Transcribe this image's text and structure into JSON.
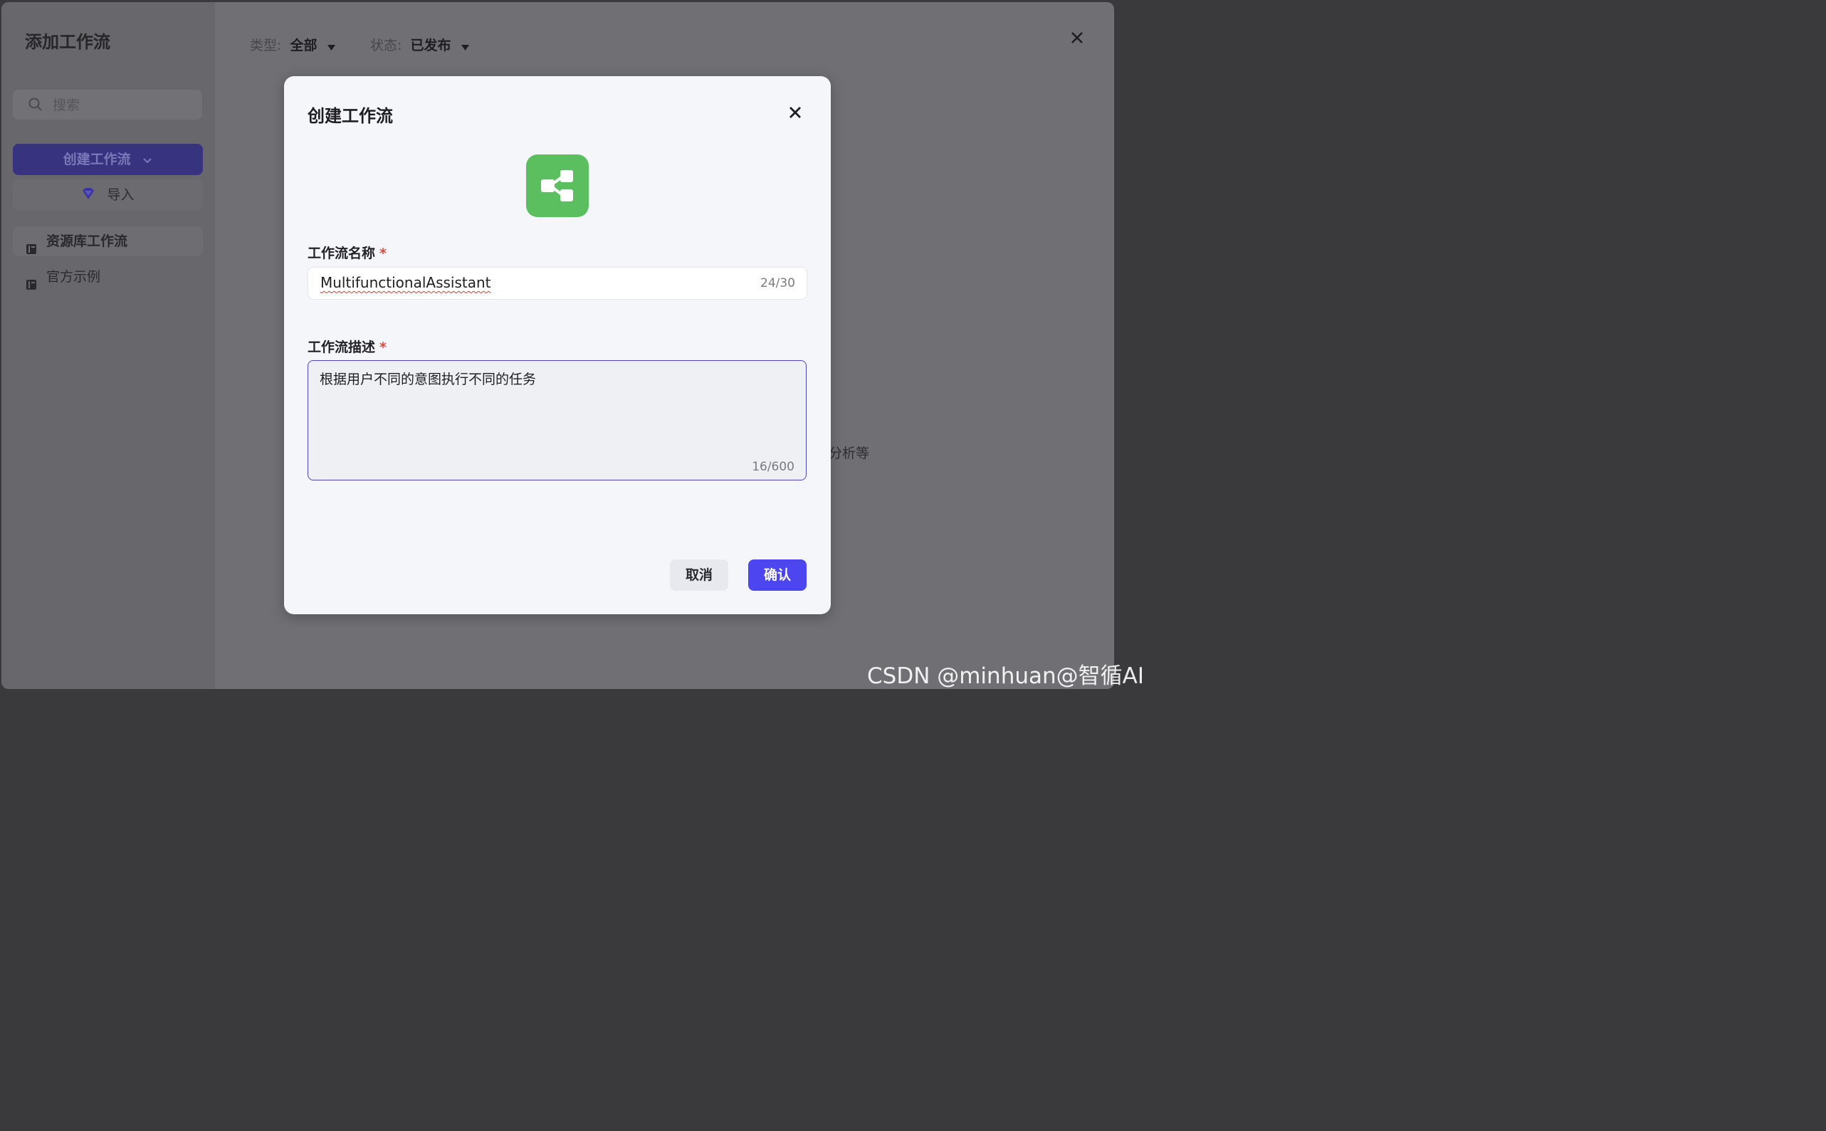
{
  "app": {
    "title": "添加工作流",
    "close_icon": "close-icon"
  },
  "sidebar": {
    "search_placeholder": "搜索",
    "create_button_label": "创建工作流",
    "import_button_label": "导入",
    "nav_items": [
      {
        "label": "资源库工作流",
        "icon": "book-icon",
        "active": true
      },
      {
        "label": "官方示例",
        "icon": "book-icon",
        "active": false
      }
    ]
  },
  "filters": {
    "type_label": "类型:",
    "type_value": "全部",
    "status_label": "状态:",
    "status_value": "已发布"
  },
  "background_text": "分析等",
  "dialog": {
    "title": "创建工作流",
    "icon": "workflow-icon",
    "name_label": "工作流名称",
    "name_value": "MultifunctionalAssistant",
    "name_counter": "24/30",
    "desc_label": "工作流描述",
    "desc_value": "根据用户不同的意图执行不同的任务",
    "desc_counter": "16/600",
    "required_mark": "*",
    "cancel_label": "取消",
    "confirm_label": "确认",
    "colors": {
      "primary": "#4c45f0",
      "icon_bg": "#5bbf5f",
      "required": "#e5483a"
    }
  },
  "watermark": "CSDN @minhuan@智循AI"
}
